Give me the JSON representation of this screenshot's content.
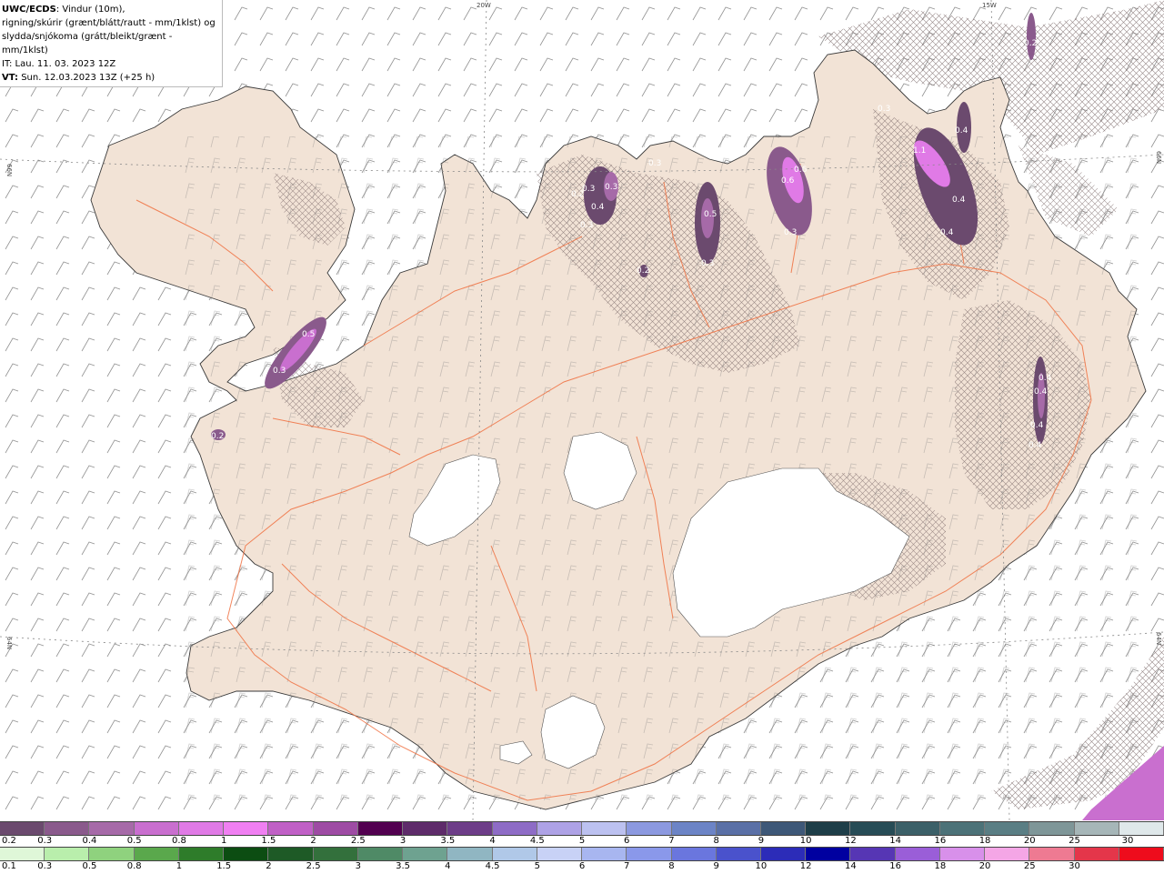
{
  "header": {
    "title": "UWC/ECDS",
    "description_line1": ": Vindur (10m),",
    "description_line2": "rigning/skúrir (grænt/blátt/rautt - mm/1klst) og",
    "description_line3": "slydda/snjókoma (grátt/bleikt/grænt - mm/1klst)",
    "it_line": "IT: Lau. 11. 03. 2023 12Z",
    "vt_label": "VT:",
    "vt_value": " Sun. 12.03.2023 13Z (+25 h)"
  },
  "grid_labels": {
    "lon_20w": "20W",
    "lon_15w": "15W",
    "lat_66n_left": "66N",
    "lat_66n_right": "66N",
    "lat_64n_left": "64N",
    "lat_64n_right": "64N"
  },
  "precip_labels": [
    "0.2",
    "0.5",
    "0.3",
    "0.3",
    "0.2",
    "0.3",
    "0.4",
    "0.3",
    "0.3",
    "0.2",
    "0.5",
    "0.3",
    "0.6",
    "0.6",
    "0.3",
    "1.1",
    "0.4",
    "0.4",
    "0.4",
    "0.3",
    "0.4",
    "0.4",
    "0.4",
    "0.4",
    "0.2"
  ],
  "colorbar_snow": {
    "ticks": [
      "0.2",
      "0.3",
      "0.4",
      "0.5",
      "0.8",
      "1",
      "1.5",
      "2",
      "2.5",
      "3",
      "3.5",
      "4",
      "4.5",
      "5",
      "6",
      "7",
      "8",
      "9",
      "10",
      "12",
      "14",
      "16",
      "18",
      "20",
      "25",
      "30"
    ],
    "colors": [
      "#6b4a6e",
      "#8a5a8c",
      "#a66aa8",
      "#c96fcf",
      "#e07ae6",
      "#f07ff2",
      "#c060c6",
      "#9e4ba4",
      "#520050",
      "#5e2b6a",
      "#6d3d88",
      "#8e6cc6",
      "#aea2e6",
      "#bcc1f0",
      "#8c99e0",
      "#6c84c6",
      "#5a70a6",
      "#3e5878",
      "#1e3e48",
      "#274c56",
      "#3c6068",
      "#4c7278",
      "#5a7e84",
      "#7e9698",
      "#a6b6b8",
      "#dfe8ea"
    ]
  },
  "colorbar_rain": {
    "ticks": [
      "0.1",
      "0.3",
      "0.5",
      "0.8",
      "1",
      "1.5",
      "2",
      "2.5",
      "3",
      "3.5",
      "4",
      "4.5",
      "5",
      "6",
      "7",
      "8",
      "9",
      "10",
      "12",
      "14",
      "16",
      "18",
      "20",
      "25",
      "30"
    ],
    "colors": [
      "#dff7d8",
      "#b9eeac",
      "#8fd27e",
      "#5aa84c",
      "#2e7c2a",
      "#0c4d12",
      "#1e5a26",
      "#33703c",
      "#4f8a66",
      "#6ea290",
      "#90b6c2",
      "#b0c8e8",
      "#c8d2f6",
      "#a8b6f0",
      "#8a98ea",
      "#6a76de",
      "#4a52cc",
      "#2c2cb8",
      "#0000a0",
      "#5636b4",
      "#9a5ed8",
      "#d890ea",
      "#f4a6e6",
      "#ee7a92",
      "#e4364a",
      "#ee0c1c"
    ]
  },
  "colors": {
    "land": "#f2e3d6",
    "coast": "#3a3a3a",
    "roads": "#f07040",
    "glacier": "#ffffff",
    "hatch": "#7c6a6a"
  }
}
